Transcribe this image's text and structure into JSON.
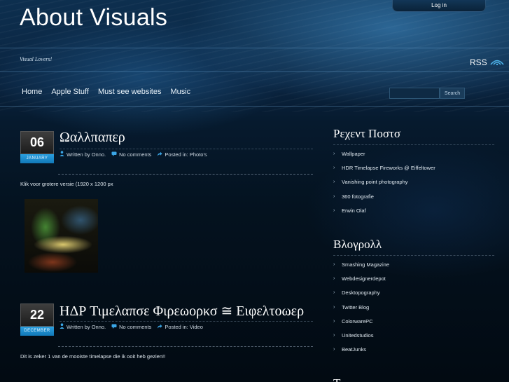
{
  "header": {
    "site_title": "About Visuals",
    "tagline": "Visual Lovers!",
    "login_label": "Log in",
    "rss_label": "RSS"
  },
  "nav": {
    "items": [
      {
        "label": "Home"
      },
      {
        "label": "Apple Stuff"
      },
      {
        "label": "Must see websites"
      },
      {
        "label": "Music"
      }
    ]
  },
  "search": {
    "placeholder": "",
    "button_label": "Search"
  },
  "posts": [
    {
      "day": "06",
      "month": "JANUARY",
      "title": "Ωαλλπαπερ",
      "author": "Written by Onno.",
      "comments": "No comments",
      "category": "Posted in: Photo's",
      "excerpt": "Klik voor grotere versie (1920 x 1200 px"
    },
    {
      "day": "22",
      "month": "DECEMBER",
      "title": "ΗΔΡ Τιμελαπσε Φιρεωορκσ ≅ Ειφελτοωερ",
      "author": "Written by Onno.",
      "comments": "No comments",
      "category": "Posted in: Video",
      "excerpt": "Dit is zeker 1 van de mooiste timelapse die ik ooit heb gezien!!"
    }
  ],
  "sidebar": {
    "recent_title": "Ρεχεντ Ποστσ",
    "recent_items": [
      {
        "label": "Wallpaper"
      },
      {
        "label": "HDR Timelapse Fireworks @ Eiffeltower"
      },
      {
        "label": "Vanishing point photography"
      },
      {
        "label": "360 fotografie"
      },
      {
        "label": "Erwin Olaf"
      }
    ],
    "blogroll_title": "Βλογρολλ",
    "blogroll_items": [
      {
        "label": "Smashing Magazine"
      },
      {
        "label": "Webdesignerdepot"
      },
      {
        "label": "Desktopography"
      },
      {
        "label": "Twitter Blog"
      },
      {
        "label": "ColorwarePC"
      },
      {
        "label": "Unitedstudios"
      },
      {
        "label": "BeatJunks"
      }
    ],
    "cutoff_title": "Τ"
  },
  "colors": {
    "accent_blue": "#1a8ed1",
    "badge_dark": "#2a2a2a",
    "background_top": "#0d2f4f",
    "background_bottom": "#020a12"
  }
}
